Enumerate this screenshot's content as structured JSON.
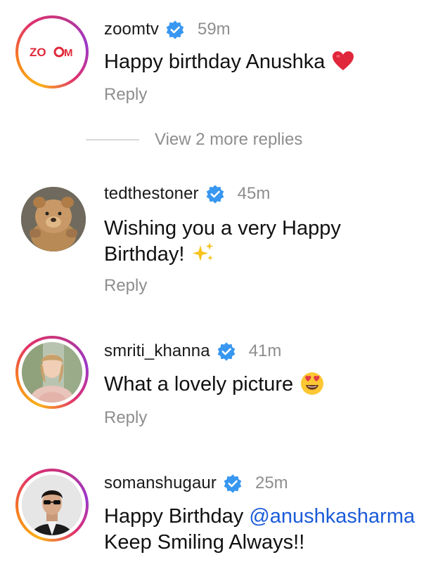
{
  "comments": [
    {
      "username": "zoomtv",
      "time": "59m",
      "text": "Happy birthday Anushka",
      "reply_label": "Reply",
      "avatar_logo_text": "ZOOM"
    },
    {
      "username": "tedthestoner",
      "time": "45m",
      "text_line1": "Wishing you a very Happy",
      "text_line2": "Birthday!",
      "reply_label": "Reply"
    },
    {
      "username": "smriti_khanna",
      "time": "41m",
      "text": "What a lovely picture",
      "reply_label": "Reply"
    },
    {
      "username": "somanshugaur",
      "time": "25m",
      "text_line1": "Happy Birthday",
      "mention": "@anushkasharma",
      "text_line2": "Keep Smiling Always!!"
    }
  ],
  "more_replies": {
    "label": "View 2 more replies"
  },
  "colors": {
    "verified_badge": "#3897f0",
    "mention": "#1b5bd8",
    "secondary_text": "#8e8e8e",
    "zoom_logo": "#e02a3c"
  },
  "icons": [
    "verified-badge-icon",
    "red-heart-emoji",
    "sparkles-emoji",
    "heart-eyes-emoji"
  ]
}
